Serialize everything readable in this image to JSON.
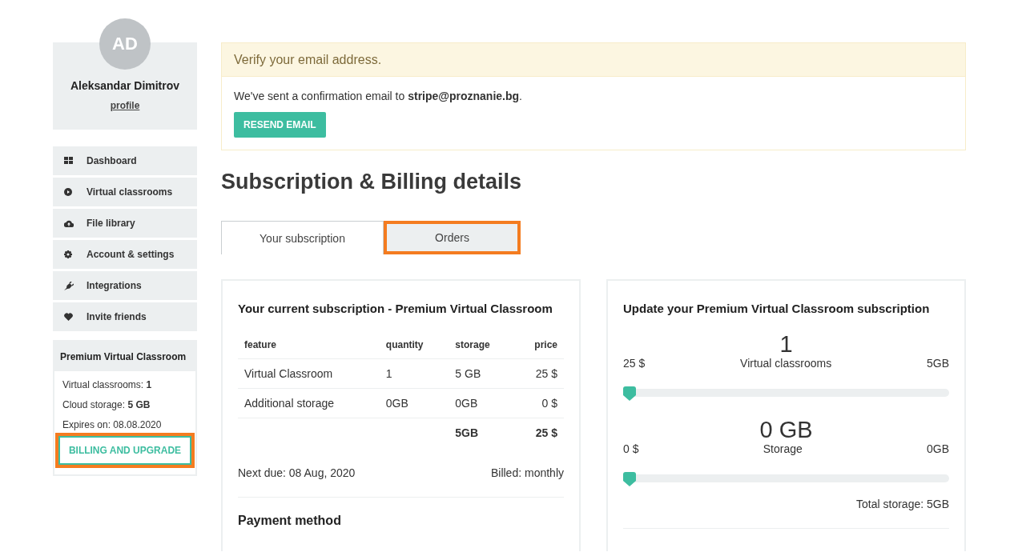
{
  "user": {
    "initials": "AD",
    "name": "Aleksandar Dimitrov",
    "profile_link": "profile"
  },
  "nav": [
    {
      "label": "Dashboard"
    },
    {
      "label": "Virtual classrooms"
    },
    {
      "label": "File library"
    },
    {
      "label": "Account & settings"
    },
    {
      "label": "Integrations"
    },
    {
      "label": "Invite friends"
    }
  ],
  "plan": {
    "title": "Premium Virtual Classroom",
    "lines": [
      "Virtual classrooms: **1**",
      "Cloud storage: **5 GB**",
      "Expires on: 08.08.2020"
    ],
    "button": {
      "label": "BILLING AND UPGRADE",
      "highlighted": true
    }
  },
  "alert": {
    "title": "Verify your email address.",
    "message": "We've sent a confirmation email to **stripe@proznanie.bg**.",
    "button": "RESEND EMAIL"
  },
  "page_title": "Subscription & Billing details",
  "tabs": [
    {
      "label": "Your subscription",
      "selected": true,
      "highlighted": false
    },
    {
      "label": "Orders",
      "selected": false,
      "highlighted": true
    }
  ],
  "current": {
    "title": "Your current subscription - Premium Virtual Classroom",
    "columns": [
      "feature",
      "quantity",
      "storage",
      "price"
    ],
    "rows": [
      [
        "Virtual Classroom",
        "1",
        "5 GB",
        "25 $"
      ],
      [
        "Additional storage",
        "0GB",
        "0GB",
        "0 $"
      ]
    ],
    "totals": {
      "storage": "5GB",
      "price": "25 $"
    },
    "next_due": "Next due: 08 Aug, 2020",
    "billed": "Billed: monthly",
    "payment_title": "Payment method"
  },
  "update": {
    "title": "Update your Premium Virtual Classroom subscription",
    "sliders": [
      {
        "value": "1",
        "price": "25 $",
        "label": "Virtual classrooms",
        "storage": "5GB",
        "level": 0
      },
      {
        "value": "0 GB",
        "price": "0 $",
        "label": "Storage",
        "storage": "0GB",
        "level": 0
      }
    ],
    "total": "Total storage: 5GB"
  }
}
